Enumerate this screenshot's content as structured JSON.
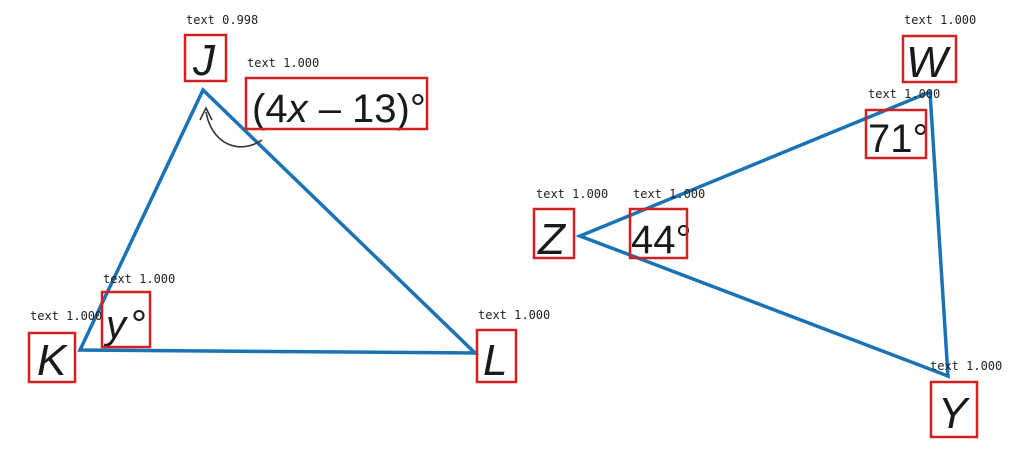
{
  "colors": {
    "triangle_stroke": "#1a73b5",
    "annotation_box": "#d42020",
    "label_text": "#1a1a1a"
  },
  "figure_left": {
    "vertices": {
      "top": "J",
      "left": "K",
      "right": "L"
    },
    "angle_J": {
      "open": "(4",
      "var": "x",
      "rest": " – 13)°"
    },
    "angle_K": {
      "var": "y",
      "deg": "°"
    }
  },
  "figure_right": {
    "vertices": {
      "left": "Z",
      "top": "W",
      "bottom": "Y"
    },
    "angle_Z": "44°",
    "angle_W": "71°"
  },
  "annotations": {
    "tag_J": "text 0.998",
    "tag_angle_J": "text 1.000",
    "tag_K": "text 1.000",
    "tag_angle_K": "text 1.000",
    "tag_L": "text 1.000",
    "tag_W": "text 1.000",
    "tag_angle_W": "text 1.000",
    "tag_Z": "text 1.000",
    "tag_angle_Z": "text 1.000",
    "tag_Y": "text 1.000"
  }
}
